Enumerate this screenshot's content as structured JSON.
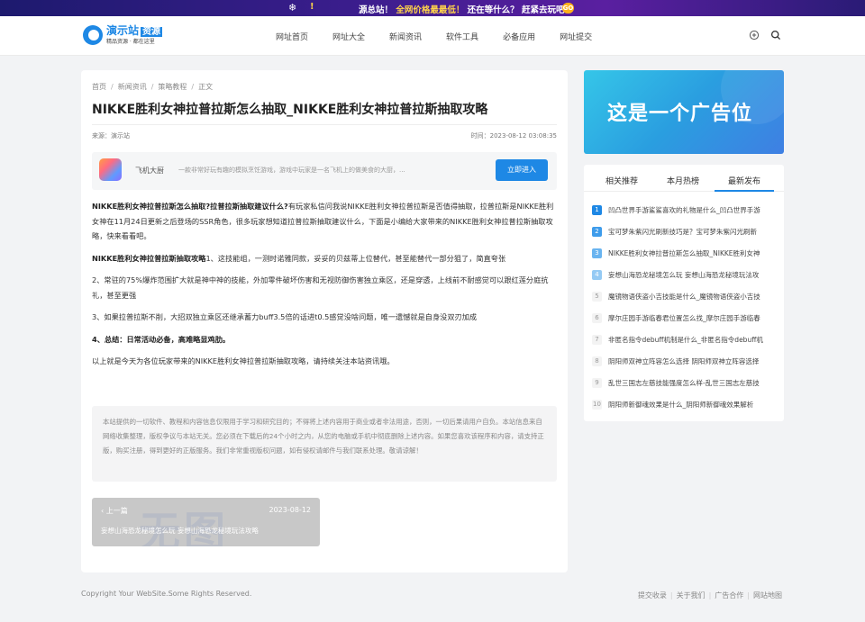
{
  "banner": {
    "text_a": "源总站！",
    "text_b": "全网价格最最低！",
    "text_c": "还在等什么？",
    "text_d": "赶紧去玩吧",
    "go": "GO"
  },
  "header": {
    "logo_name": "演示站",
    "logo_tag": "资源",
    "logo_slogan": "精品资源 · 都在这里",
    "nav": [
      "网址首页",
      "网址大全",
      "新闻资讯",
      "软件工具",
      "必备应用",
      "网址提交"
    ]
  },
  "article": {
    "breadcrumb": [
      "首页",
      "新闻资讯",
      "策略教程",
      "正文"
    ],
    "title": "NIKKE胜利女神拉普拉斯怎么抽取_NIKKE胜利女神拉普拉斯抽取攻略",
    "source": "来源：演示站",
    "time": "时间：2023-08-12 03:08:35",
    "app": {
      "name": "飞机大厨",
      "desc": "一款非常好玩有趣的模拟烹饪游戏，游戏中玩家是一名飞机上的做美食的大厨，...",
      "button": "立即进入"
    },
    "p1_bold": "NIKKE胜利女神拉普拉斯怎么抽取?拉普拉斯抽取建议什么?",
    "p1_text": "有玩家私信问我说NIKKE胜利女神拉普拉斯是否值得抽取，拉普拉斯是NIKKE胜利女神在11月24日更新之后登场的SSR角色，很多玩家想知道拉普拉斯抽取建议什么，下面是小编给大家带来的NIKKE胜利女神拉普拉斯抽取攻略，快来看看吧。",
    "p2_bold": "NIKKE胜利女神拉普拉斯抽取攻略",
    "p2_text": "1、这技能组，一测时诺雅同款，妥妥的贝兹蒂上位替代，甚至能替代一部分狙了，简直夸张",
    "p3": "2、常驻的75%爆炸范围扩大就是神中神的技能，外加零件破坏伤害和无视防御伤害独立乘区，还是穿透，上线前不耐感觉可以跟红莲分庭抗礼，甚至更强",
    "p4": "3、如果拉普拉斯不削，大招双独立乘区还继承蓄力buff3.5倍的话进t0.5感觉没啥问题，唯一遗憾就是自身没双刃加成",
    "p5_bold": "4、总结：日常活动必备，高难略显鸡肋。",
    "p6": "以上就是今天为各位玩家带来的NIKKE胜利女神拉普拉斯抽取攻略，请持续关注本站资讯哦。",
    "notice": "本站提供的一切软件、教程和内容信息仅限用于学习和研究目的；不得将上述内容用于商业或者非法用途，否则，一切后果请用户自负。本站信息来自网络收集整理，版权争议与本站无关。您必须在下载后的24个小时之内，从您的电脑或手机中彻底删除上述内容。如果您喜欢该程序和内容，请支持正版，购买注册，得到更好的正版服务。我们非常重视版权问题，如有侵权请邮件与我们联系处理。敬请谅解！",
    "prev": {
      "label": "上一篇",
      "date": "2023-08-12",
      "title": "妄想山海恐龙秘境怎么玩 妄想山海恐龙秘境玩法攻略",
      "watermark": "无图"
    }
  },
  "sidebar": {
    "ad_text": "这是一个广告位",
    "tabs": [
      "相关推荐",
      "本月热榜",
      "最新发布"
    ],
    "items": [
      {
        "num": "1",
        "text": "凹凸世界手游鲨鲨喜欢的礼物是什么_凹凸世界手游"
      },
      {
        "num": "2",
        "text": "宝可梦朱紫闪光刷新技巧是？宝可梦朱紫闪光刷新"
      },
      {
        "num": "3",
        "text": "NIKKE胜利女神拉普拉斯怎么抽取_NIKKE胜利女神"
      },
      {
        "num": "4",
        "text": "妄想山海恐龙秘境怎么玩 妄想山海恐龙秘境玩法攻"
      },
      {
        "num": "5",
        "text": "魔镜物语侠盗小吉技能是什么_魔镜物语侠盗小吉技"
      },
      {
        "num": "6",
        "text": "摩尔庄园手游临春君位置怎么找_摩尔庄园手游临春"
      },
      {
        "num": "7",
        "text": "非匿名指令debuff机制是什么_非匿名指令debuff机"
      },
      {
        "num": "8",
        "text": "阴阳师双神立阵容怎么选择 阴阳师双神立阵容选择"
      },
      {
        "num": "9",
        "text": "乱世三国志左慈技能强度怎么样-乱世三国志左慈技"
      },
      {
        "num": "10",
        "text": "阴阳师新御魂效果是什么_阴阳师新御魂效果解析"
      }
    ]
  },
  "footer": {
    "copyright": "Copyright Your WebSite.Some Rights Reserved.",
    "links": [
      "提交收录",
      "关于我们",
      "广告合作",
      "网站地图"
    ]
  },
  "colors": {
    "accent": "#1e88e5",
    "background": "#f2f3f5"
  }
}
